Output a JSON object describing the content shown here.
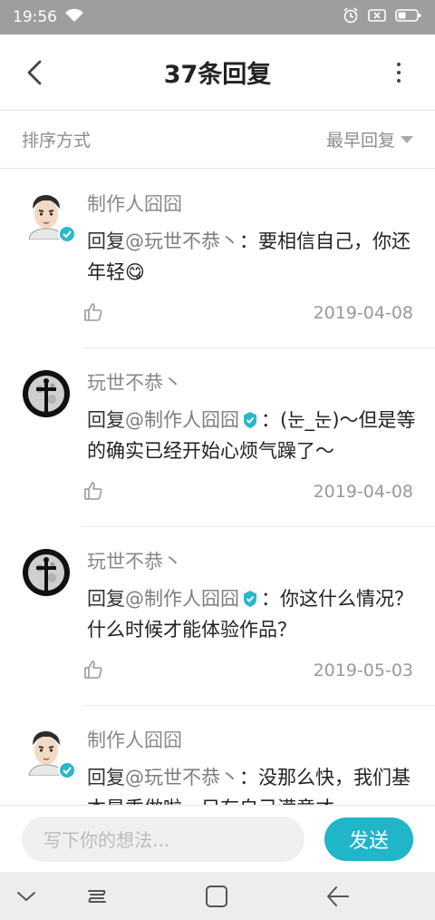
{
  "status": {
    "time": "19:56"
  },
  "header": {
    "title": "37条回复"
  },
  "sort": {
    "label": "排序方式",
    "selected": "最早回复"
  },
  "replies": [
    {
      "author": "制作人囧囧",
      "prefix": "回复",
      "mention": "@玩世不恭丶",
      "sep": "：",
      "text": "要相信自己，你还年轻",
      "emoji": "😋",
      "date": "2019-04-08"
    },
    {
      "author": "玩世不恭丶",
      "prefix": "回复",
      "mention": "@制作人囧囧",
      "sep": "：",
      "text": "(눈_눈)～但是等的确实已经开始心烦气躁了～",
      "date": "2019-04-08"
    },
    {
      "author": "玩世不恭丶",
      "prefix": "回复",
      "mention": "@制作人囧囧",
      "sep": "：",
      "text": "你这什么情况？什么时候才能体验作品？",
      "date": "2019-05-03"
    },
    {
      "author": "制作人囧囧",
      "prefix": "回复",
      "mention": "@玩世不恭丶",
      "sep": "：",
      "text": "没那么快，我们基本是乘做啦，只有自己满意才"
    }
  ],
  "input": {
    "placeholder": "写下你的想法..."
  },
  "send_label": "发送",
  "colors": {
    "accent": "#20b5c9",
    "verified": "#2bb7c9"
  }
}
